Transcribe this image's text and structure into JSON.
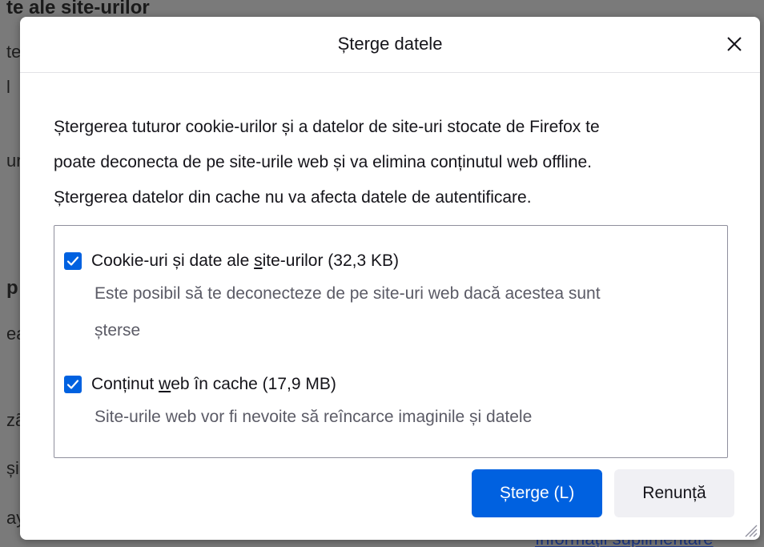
{
  "background": {
    "heading": "te ale site-urilor",
    "fragments": [
      "te",
      "l",
      "ur",
      "p",
      "ea",
      "zã",
      "și",
      "ay"
    ],
    "link": "Informații suplimentare"
  },
  "dialog": {
    "title": "Șterge datele",
    "close_icon": "close-icon",
    "description": [
      "Ștergerea tuturor cookie-urilor și a datelor de site-uri stocate de Firefox te",
      "poate deconecta de pe site-urile web și va elimina conținutul web offline.",
      "Ștergerea datelor din cache nu va afecta datele de autentificare."
    ],
    "options": [
      {
        "label_before": "Cookie-uri și date ale ",
        "label_access": "s",
        "label_after": "ite-urilor (32,3 KB)",
        "checked": true,
        "description_line1": "Este posibil să te deconecteze de pe site-uri web dacă acestea sunt",
        "description_line2": "șterse"
      },
      {
        "label_before": "Conținut ",
        "label_access": "w",
        "label_after": "eb în cache (17,9 MB)",
        "checked": true,
        "description_line1": "Site-urile web vor fi nevoite să reîncarce imaginile și datele"
      }
    ],
    "buttons": {
      "primary": "Șterge (L)",
      "secondary": "Renunță"
    }
  },
  "colors": {
    "accent": "#0061e0",
    "secondary_button": "#f0f0f4",
    "overlay": "#7a7a7a",
    "muted_text": "#5b5b66"
  }
}
